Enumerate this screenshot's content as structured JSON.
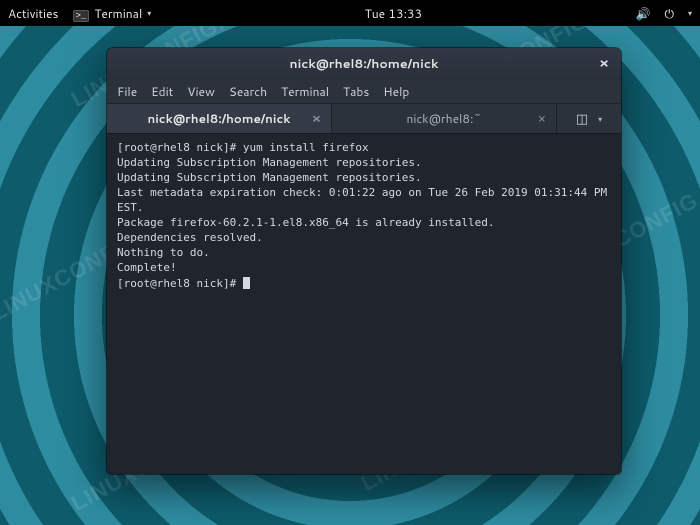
{
  "topbar": {
    "activities": "Activities",
    "app_label": "Terminal",
    "clock": "Tue 13:33"
  },
  "window": {
    "title": "nick@rhel8:/home/nick",
    "menus": [
      "File",
      "Edit",
      "View",
      "Search",
      "Terminal",
      "Tabs",
      "Help"
    ],
    "tabs": [
      {
        "label": "nick@rhel8:/home/nick",
        "active": true
      },
      {
        "label": "nick@rhel8:~",
        "active": false
      }
    ]
  },
  "terminal": {
    "lines": [
      "[root@rhel8 nick]# yum install firefox",
      "Updating Subscription Management repositories.",
      "Updating Subscription Management repositories.",
      "Last metadata expiration check: 0:01:22 ago on Tue 26 Feb 2019 01:31:44 PM EST.",
      "Package firefox-60.2.1-1.el8.x86_64 is already installed.",
      "Dependencies resolved.",
      "Nothing to do.",
      "Complete!",
      "[root@rhel8 nick]# "
    ]
  },
  "watermark_text": "LINUXCONFIG.ORG"
}
